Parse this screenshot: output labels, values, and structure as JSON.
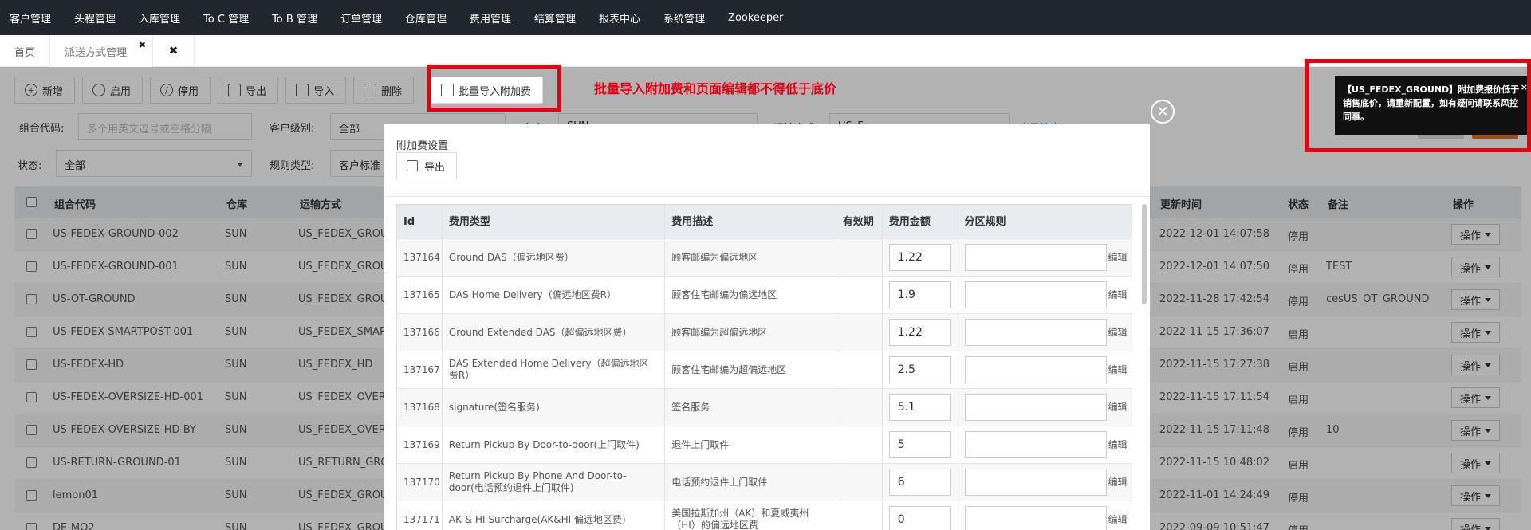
{
  "topnav": [
    "客户管理",
    "头程管理",
    "入库管理",
    "To C 管理",
    "To B 管理",
    "订单管理",
    "仓库管理",
    "费用管理",
    "结算管理",
    "报表中心",
    "系统管理",
    "Zookeeper"
  ],
  "tabs": {
    "home": "首页",
    "current": "派送方式管理",
    "close_current": "✖",
    "close_all": "✖"
  },
  "toolbar": {
    "add": "新增",
    "enable": "启用",
    "disable": "停用",
    "export": "导出",
    "import": "导入",
    "delete": "删除",
    "batch_import": "批量导入附加费"
  },
  "annotation": "批量导入附加费和页面编辑都不得低于底价",
  "filters": {
    "combo_code_label": "组合代码:",
    "combo_code_placeholder": "多个用英文逗号或空格分隔",
    "customer_level_label": "客户级别:",
    "customer_level_value": "全部",
    "status_label": "状态:",
    "status_value": "全部",
    "rule_type_label": "规则类型:",
    "rule_type_value": "客户标准",
    "warehouse_label": "仓库",
    "warehouse_value": "SUN",
    "shipping_label": "运输方式",
    "shipping_value": "US_F",
    "advanced_search": "高级搜索"
  },
  "grid": {
    "headers": {
      "code": "组合代码",
      "warehouse": "仓库",
      "shipping": "运输方式",
      "updated": "更新时间",
      "status": "状态",
      "remark": "备注",
      "action": "操作"
    },
    "rows": [
      {
        "code": "US-FEDEX-GROUND-002",
        "warehouse": "SUN",
        "shipping": "US_FEDEX_GROUND",
        "updated": "2022-12-01 14:07:58",
        "status": "停用",
        "remark": "",
        "action": "操作"
      },
      {
        "code": "US-FEDEX-GROUND-001",
        "warehouse": "SUN",
        "shipping": "US_FEDEX_GROUND",
        "updated": "2022-12-01 14:07:50",
        "status": "停用",
        "remark": "TEST",
        "action": "操作"
      },
      {
        "code": "US-OT-GROUND",
        "warehouse": "SUN",
        "shipping": "US_FEDEX_GROUND",
        "updated": "2022-11-28 17:42:54",
        "status": "停用",
        "remark": "cesUS_OT_GROUND",
        "action": "操作"
      },
      {
        "code": "US-FEDEX-SMARTPOST-001",
        "warehouse": "SUN",
        "shipping": "US_FEDEX_SMARTPOST",
        "updated": "2022-11-15 17:36:07",
        "status": "启用",
        "remark": "",
        "action": "操作"
      },
      {
        "code": "US-FEDEX-HD",
        "warehouse": "SUN",
        "shipping": "US_FEDEX_HD",
        "updated": "2022-11-15 17:27:38",
        "status": "启用",
        "remark": "",
        "action": "操作"
      },
      {
        "code": "US-FEDEX-OVERSIZE-HD-001",
        "warehouse": "SUN",
        "shipping": "US_FEDEX_OVERSIZE",
        "updated": "2022-11-15 17:11:54",
        "status": "启用",
        "remark": "",
        "action": "操作"
      },
      {
        "code": "US-FEDEX-OVERSIZE-HD-BY",
        "warehouse": "SUN",
        "shipping": "US_FEDEX_OVERSIZE",
        "updated": "2022-11-15 17:11:48",
        "status": "停用",
        "remark": "10",
        "action": "操作"
      },
      {
        "code": "US-RETURN-GROUND-01",
        "warehouse": "SUN",
        "shipping": "US_RETURN_GROUND",
        "updated": "2022-11-15 10:48:02",
        "status": "启用",
        "remark": "",
        "action": "操作"
      },
      {
        "code": "lemon01",
        "warehouse": "SUN",
        "shipping": "US_FEDEX_GROUND",
        "updated": "2022-11-01 14:24:49",
        "status": "停用",
        "remark": "",
        "action": "操作"
      },
      {
        "code": "DE-MO2",
        "warehouse": "SUN",
        "shipping": "US_FEDEX_GROUND",
        "updated": "2022-09-09 10:51:47",
        "status": "停用",
        "remark": "",
        "action": "操作"
      }
    ]
  },
  "modal": {
    "title": "附加费设置",
    "export": "导出",
    "close": "✕",
    "headers": {
      "id": "Id",
      "fee_type": "费用类型",
      "fee_desc": "费用描述",
      "validity": "有效期",
      "amount": "费用金额",
      "zone_rule": "分区规则"
    },
    "edit_label": "编辑",
    "rows": [
      {
        "id": "137164",
        "fee_type": "Ground DAS（偏远地区费）",
        "fee_desc": "顾客邮编为偏远地区",
        "validity": "",
        "amount": "1.22",
        "zone_rule": ""
      },
      {
        "id": "137165",
        "fee_type": "DAS Home Delivery（偏远地区费R）",
        "fee_desc": "顾客住宅邮编为偏远地区",
        "validity": "",
        "amount": "1.9",
        "zone_rule": ""
      },
      {
        "id": "137166",
        "fee_type": "Ground Extended DAS（超偏远地区费）",
        "fee_desc": "顾客邮编为超偏远地区",
        "validity": "",
        "amount": "1.22",
        "zone_rule": ""
      },
      {
        "id": "137167",
        "fee_type": "DAS Extended Home Delivery（超偏远地区费R）",
        "fee_desc": "顾客住宅邮编为超偏远地区",
        "validity": "",
        "amount": "2.5",
        "zone_rule": ""
      },
      {
        "id": "137168",
        "fee_type": "signature(签名服务)",
        "fee_desc": "签名服务",
        "validity": "",
        "amount": "5.1",
        "zone_rule": ""
      },
      {
        "id": "137169",
        "fee_type": "Return Pickup By Door-to-door(上门取件)",
        "fee_desc": "退件上门取件",
        "validity": "",
        "amount": "5",
        "zone_rule": ""
      },
      {
        "id": "137170",
        "fee_type": "Return Pickup By Phone And Door-to-door(电话预约退件上门取件)",
        "fee_desc": "电话预约退件上门取件",
        "validity": "",
        "amount": "6",
        "zone_rule": ""
      },
      {
        "id": "137171",
        "fee_type": "AK & HI Surcharge(AK&HI 偏远地区费)",
        "fee_desc": "美国拉斯加州（AK）和夏威夷州（HI）的偏远地区费",
        "validity": "",
        "amount": "0",
        "zone_rule": ""
      }
    ]
  },
  "tooltip": {
    "text": "【US_FEDEX_GROUND】附加费报价低于销售底价，请重新配置，如有疑问请联系风控同事。",
    "close": "×"
  },
  "colors": {
    "nav_bg": "#22262d",
    "annotation_red": "#e60012",
    "header_bg": "#e7ecf1",
    "tooltip_bg": "#111111"
  }
}
